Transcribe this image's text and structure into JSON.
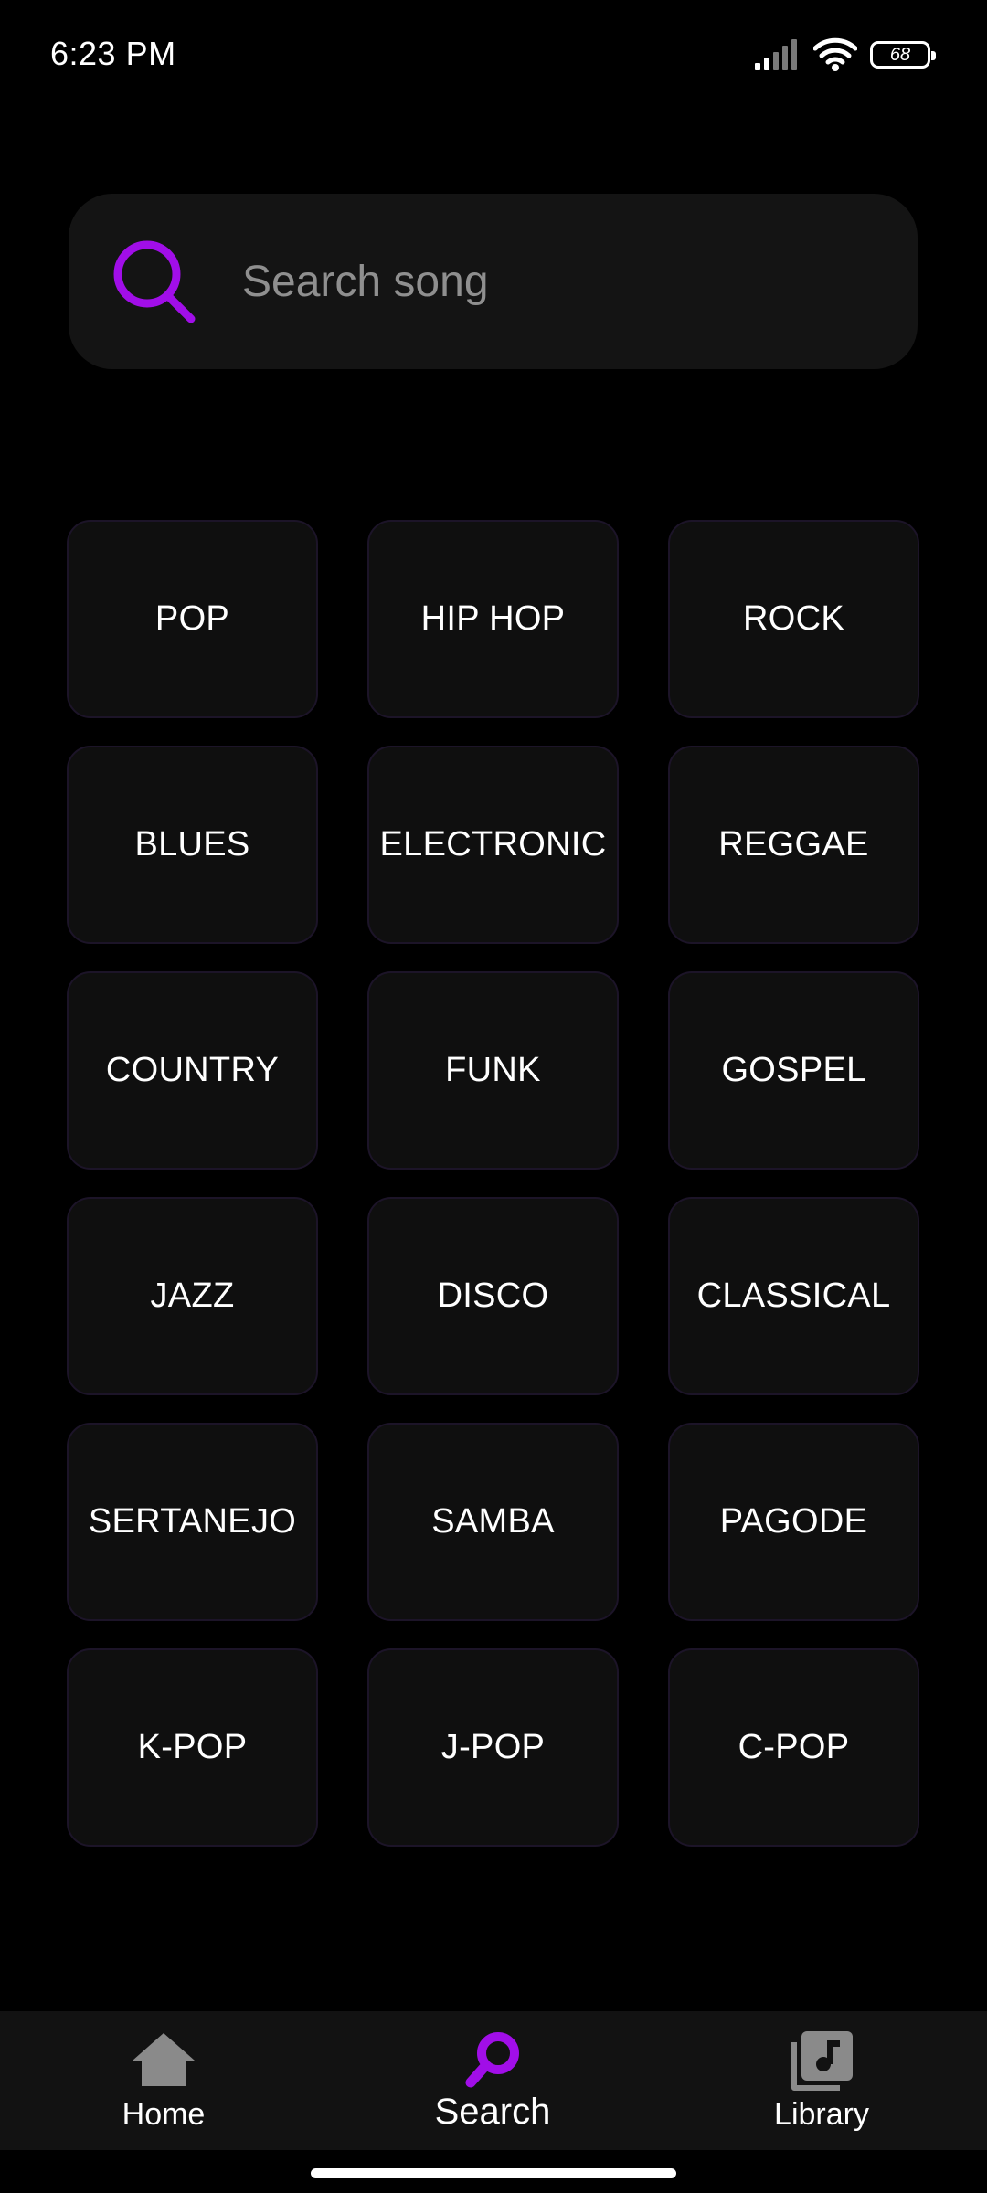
{
  "status_bar": {
    "time": "6:23 PM",
    "battery": "68",
    "icons": [
      "signal-icon",
      "wifi-icon",
      "battery-icon"
    ]
  },
  "search": {
    "placeholder": "Search song",
    "value": ""
  },
  "genres": [
    "POP",
    "HIP HOP",
    "ROCK",
    "BLUES",
    "ELECTRONIC",
    "REGGAE",
    "COUNTRY",
    "FUNK",
    "GOSPEL",
    "JAZZ",
    "DISCO",
    "CLASSICAL",
    "SERTANEJO",
    "SAMBA",
    "PAGODE",
    "K-POP",
    "J-POP",
    "C-POP"
  ],
  "nav": {
    "items": [
      {
        "label": "Home",
        "icon": "home-icon"
      },
      {
        "label": "Search",
        "icon": "search-icon"
      },
      {
        "label": "Library",
        "icon": "library-music-icon"
      }
    ],
    "active": "Search"
  },
  "colors": {
    "accent": "#a10ee8",
    "background": "#000000",
    "surface": "#141414",
    "tile": "#0f0f0f",
    "inactive_icon": "#8a8a8a"
  }
}
